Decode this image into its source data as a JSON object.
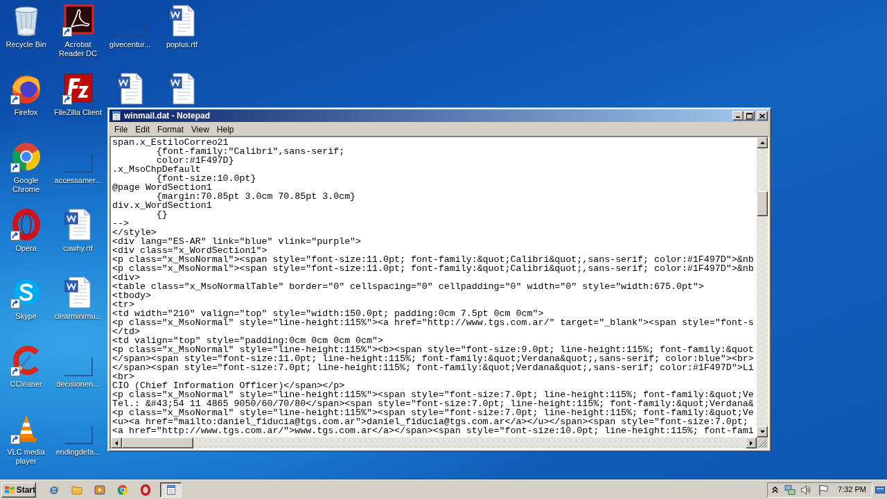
{
  "desktop": {
    "columns": [
      {
        "icons": [
          {
            "label": "Recycle Bin",
            "kind": "recycle-bin",
            "shortcut": false
          },
          {
            "label": "Firefox",
            "kind": "firefox",
            "shortcut": true
          },
          {
            "label": "Google Chrome",
            "kind": "chrome",
            "shortcut": true
          },
          {
            "label": "Opera",
            "kind": "opera",
            "shortcut": true
          },
          {
            "label": "Skype",
            "kind": "skype",
            "shortcut": true
          },
          {
            "label": "CCleaner",
            "kind": "ccleaner",
            "shortcut": true
          },
          {
            "label": "VLC media player",
            "kind": "vlc",
            "shortcut": true
          }
        ]
      },
      {
        "icons": [
          {
            "label": "Acrobat Reader DC",
            "kind": "acrobat",
            "shortcut": true
          },
          {
            "label": "FileZilla Client",
            "kind": "filezilla",
            "shortcut": true
          },
          {
            "label": "accessamer...",
            "kind": "blank",
            "shortcut": false
          },
          {
            "label": "cawhy.rtf",
            "kind": "word",
            "shortcut": false
          },
          {
            "label": "clearminimu...",
            "kind": "word",
            "shortcut": false
          },
          {
            "label": "decisionen...",
            "kind": "blank",
            "shortcut": false
          },
          {
            "label": "endingdefa...",
            "kind": "blank",
            "shortcut": false
          }
        ]
      },
      {
        "icons": [
          {
            "label": "givecentur...",
            "kind": "blank",
            "shortcut": false
          },
          {
            "kind": "word",
            "shortcut": false
          }
        ]
      },
      {
        "icons": [
          {
            "label": "poplus.rtf",
            "kind": "word",
            "shortcut": false
          },
          {
            "kind": "word",
            "shortcut": false
          }
        ]
      }
    ]
  },
  "notepad": {
    "title": "winmail.dat - Notepad",
    "menu": [
      "File",
      "Edit",
      "Format",
      "View",
      "Help"
    ],
    "lines": [
      "span.x_EstiloCorreo21",
      "        {font-family:\"Calibri\",sans-serif;",
      "        color:#1F497D}",
      ".x_MsoChpDefault",
      "        {font-size:10.0pt}",
      "@page WordSection1",
      "        {margin:70.85pt 3.0cm 70.85pt 3.0cm}",
      "div.x_WordSection1",
      "        {}",
      "-->",
      "</style>",
      "<div lang=\"ES-AR\" link=\"blue\" vlink=\"purple\">",
      "<div class=\"x_WordSection1\">",
      "<p class=\"x_MsoNormal\"><span style=\"font-size:11.0pt; font-family:&quot;Calibri&quot;,sans-serif; color:#1F497D\">&nb",
      "<p class=\"x_MsoNormal\"><span style=\"font-size:11.0pt; font-family:&quot;Calibri&quot;,sans-serif; color:#1F497D\">&nb",
      "<div>",
      "<table class=\"x_MsoNormalTable\" border=\"0\" cellspacing=\"0\" cellpadding=\"0\" width=\"0\" style=\"width:675.0pt\">",
      "<tbody>",
      "<tr>",
      "<td width=\"210\" valign=\"top\" style=\"width:150.0pt; padding:0cm 7.5pt 0cm 0cm\">",
      "<p class=\"x_MsoNormal\" style=\"line-height:115%\"><a href=\"http://www.tgs.com.ar/\" target=\"_blank\"><span style=\"font-s",
      "</td>",
      "<td valign=\"top\" style=\"padding:0cm 0cm 0cm 0cm\">",
      "<p class=\"x_MsoNormal\" style=\"line-height:115%\"><b><span style=\"font-size:9.0pt; line-height:115%; font-family:&quot",
      "</span><span style=\"font-size:11.0pt; line-height:115%; font-family:&quot;Verdana&quot;,sans-serif; color:blue\"><br>",
      "</span><span style=\"font-size:7.0pt; line-height:115%; font-family:&quot;Verdana&quot;,sans-serif; color:#1F497D\">Li",
      "<br>",
      "CIO (Chief Information Officer)</span></p>",
      "<p class=\"x_MsoNormal\" style=\"line-height:115%\"><span style=\"font-size:7.0pt; line-height:115%; font-family:&quot;Ve",
      "Tel.: &#43;54 11 4865 9050/60/70/80</span><span style=\"font-size:7.0pt; line-height:115%; font-family:&quot;Verdana&",
      "<p class=\"x_MsoNormal\" style=\"line-height:115%\"><span style=\"font-size:7.0pt; line-height:115%; font-family:&quot;Ve",
      "<u><a href=\"mailto:daniel_fiducia@tgs.com.ar\">daniel_fiducia@tgs.com.ar</a></u></span><span style=\"font-size:7.0pt;",
      "<a href=\"http://www.tgs.com.ar/\">www.tgs.com.ar</a></span><span style=\"font-size:10.0pt; line-height:115%; font-fami"
    ]
  },
  "taskbar": {
    "start_label": "Start",
    "quick_launch": [
      {
        "kind": "ie"
      },
      {
        "kind": "folder"
      },
      {
        "kind": "media-player"
      },
      {
        "kind": "chrome"
      },
      {
        "kind": "opera"
      }
    ],
    "tasks": [
      {
        "kind": "notepad",
        "active": true
      }
    ],
    "clock": "7:32 PM"
  }
}
